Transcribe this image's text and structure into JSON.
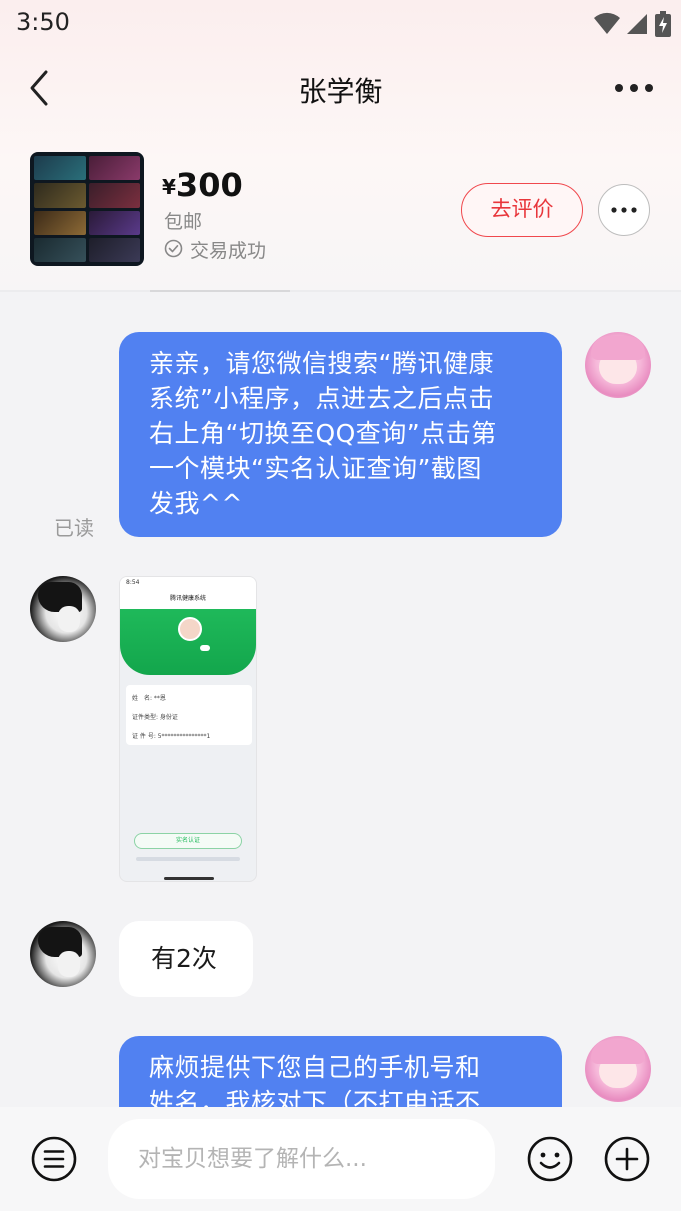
{
  "status_bar": {
    "time": "3:50"
  },
  "header": {
    "title": "张学衡"
  },
  "product": {
    "currency": "¥",
    "price": "300",
    "shipping": "包邮",
    "trade_status": "交易成功",
    "review_button": "去评价"
  },
  "messages": {
    "m1": {
      "lines": [
        "亲亲，请您微信搜索“腾讯健康",
        "系统”小程序，点进去之后点击",
        "右上角“切换至QQ查询”点击第",
        "一个模块“实名认证查询”截图",
        "发我^^"
      ],
      "read_status": "已读"
    },
    "m2": {
      "mini": {
        "time": "8:54",
        "title": "腾讯健康系统",
        "name_row": "姓　名:  **恩",
        "type_row": "证件类型:  身份证",
        "id_row": "证 件 号:  5***************1",
        "button": "实名认证"
      }
    },
    "m3": {
      "text": "有2次"
    },
    "m4": {
      "lines": [
        "麻烦提供下您自己的手机号和",
        "姓名，我核对下（不打电话不"
      ]
    }
  },
  "input": {
    "placeholder": "对宝贝想要了解什么..."
  }
}
